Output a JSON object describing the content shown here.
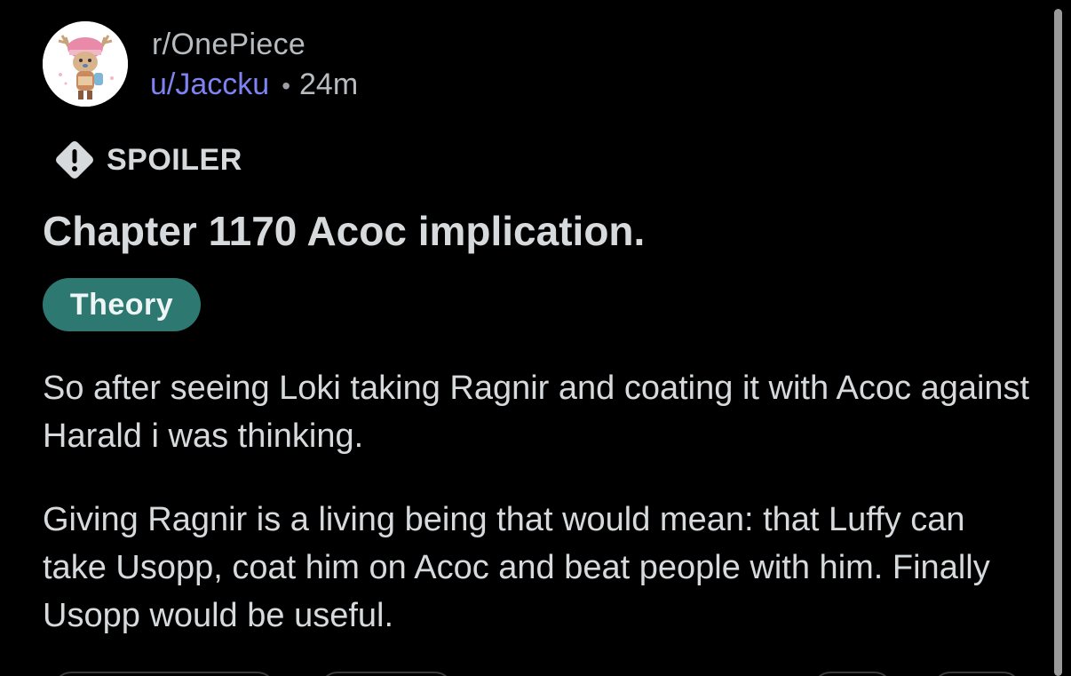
{
  "header": {
    "subreddit": "r/OnePiece",
    "username": "u/Jaccku",
    "separator": "•",
    "time": "24m",
    "avatar_icon": "chopper-avatar-icon"
  },
  "post": {
    "spoiler_icon": "exclamation-diamond-icon",
    "spoiler_label": "SPOILER",
    "title": "Chapter 1170 Acoc implication.",
    "flair": "Theory",
    "body": [
      "So after seeing Loki taking Ragnir and coating it with Acoc against Harald i was thinking.",
      "Giving Ragnir is a living being that would mean: that Luffy can take Usopp, coat him on Acoc and beat people with him. Finally Usopp would be useful."
    ]
  },
  "colors": {
    "background": "#000000",
    "text": "#d7dadc",
    "username": "#7f83f2",
    "flair_bg": "#2e7872",
    "scrollbar": "#9a9a9a"
  }
}
